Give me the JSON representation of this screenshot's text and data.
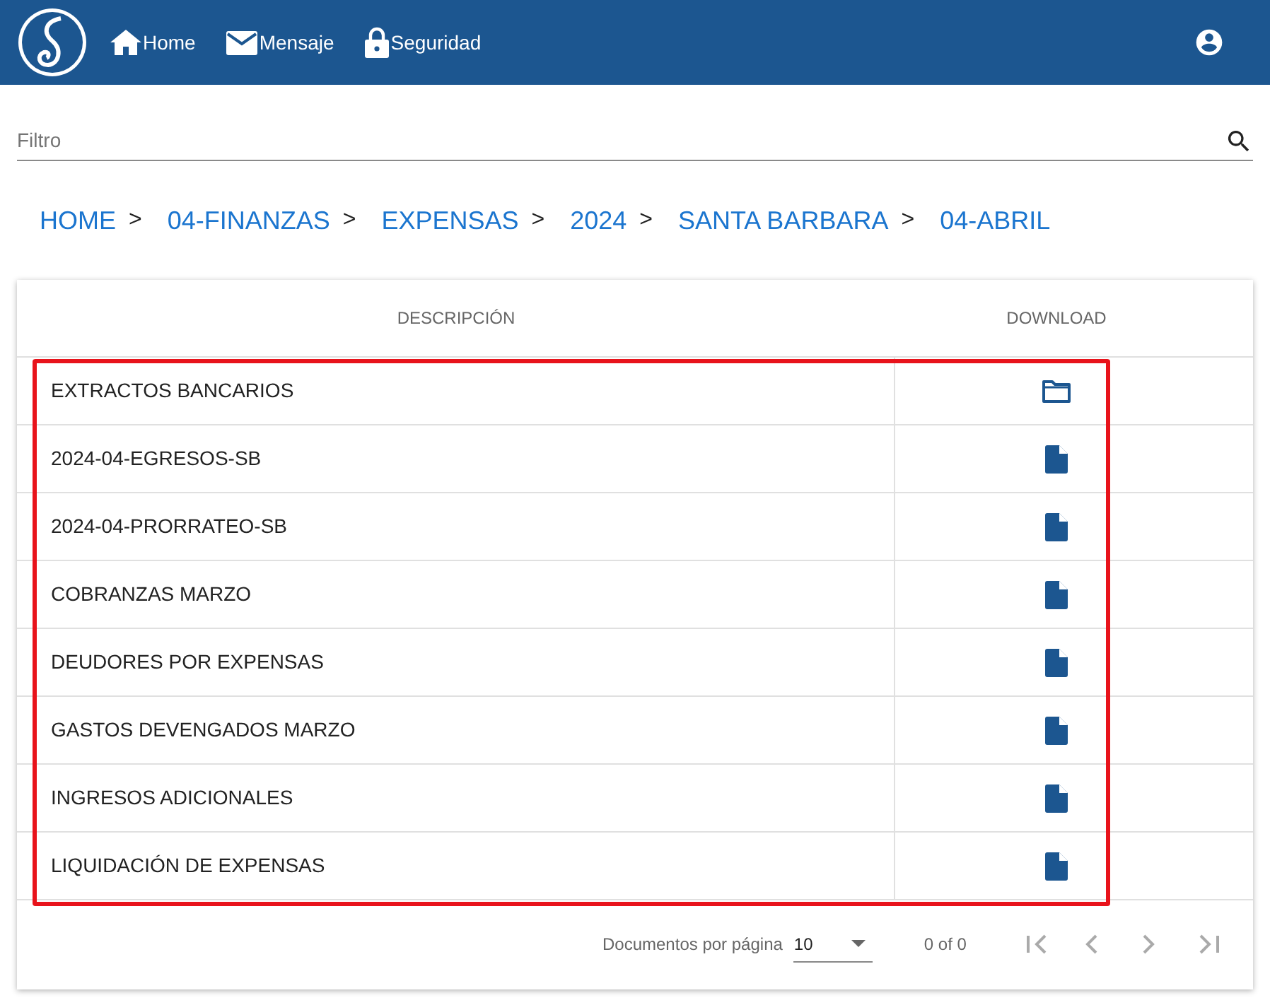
{
  "nav": {
    "items": [
      {
        "label": "Home"
      },
      {
        "label": "Mensaje"
      },
      {
        "label": "Seguridad"
      }
    ]
  },
  "filter": {
    "placeholder": "Filtro"
  },
  "breadcrumb": [
    {
      "label": "HOME",
      "separator": ">"
    },
    {
      "label": "04-FINANZAS",
      "separator": ">"
    },
    {
      "label": "EXPENSAS",
      "separator": ">"
    },
    {
      "label": "2024",
      "separator": ">"
    },
    {
      "label": "SANTA BARBARA",
      "separator": ">"
    },
    {
      "label": "04-ABRIL"
    }
  ],
  "table": {
    "columns": [
      "DESCRIPCIÓN",
      "DOWNLOAD"
    ],
    "rows": [
      {
        "description": "EXTRACTOS BANCARIOS",
        "kind": "folder"
      },
      {
        "description": "2024-04-EGRESOS-SB",
        "kind": "file"
      },
      {
        "description": "2024-04-PRORRATEO-SB",
        "kind": "file"
      },
      {
        "description": "COBRANZAS MARZO",
        "kind": "file"
      },
      {
        "description": "DEUDORES POR EXPENSAS",
        "kind": "file"
      },
      {
        "description": "GASTOS DEVENGADOS MARZO",
        "kind": "file"
      },
      {
        "description": "INGRESOS ADICIONALES",
        "kind": "file"
      },
      {
        "description": "LIQUIDACIÓN DE EXPENSAS",
        "kind": "file"
      }
    ]
  },
  "pagination": {
    "label": "Documentos por página",
    "page_size": "10",
    "range": "0 of 0"
  }
}
